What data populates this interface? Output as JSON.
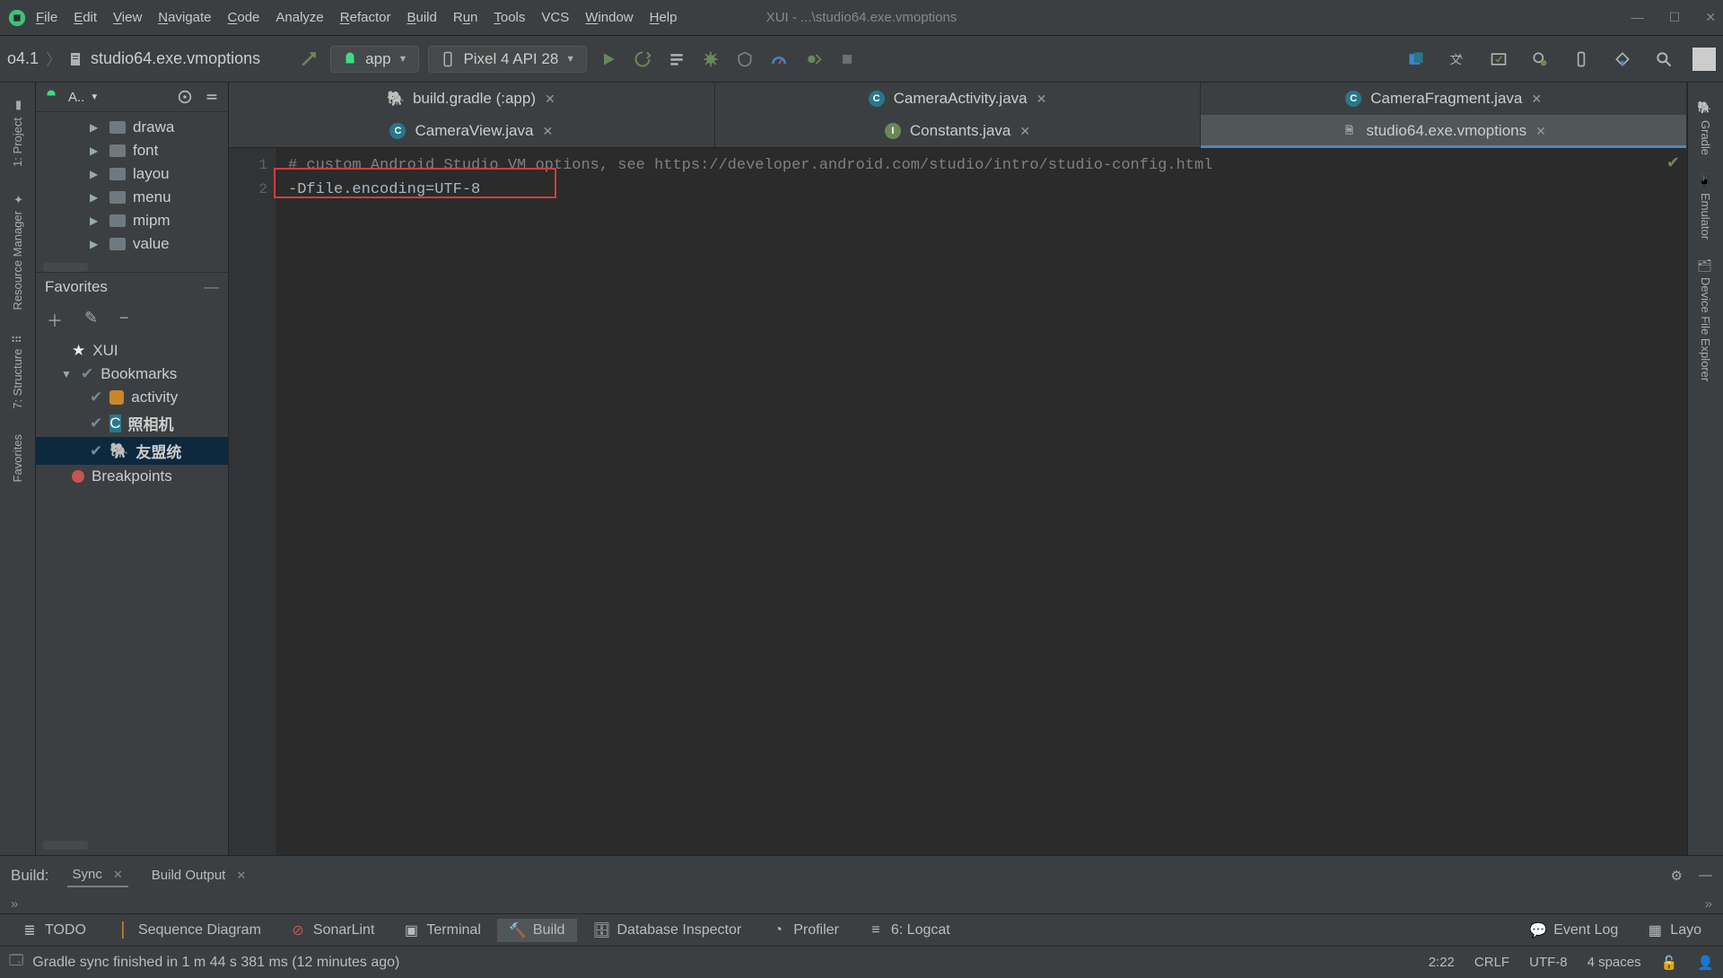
{
  "menu": [
    "File",
    "Edit",
    "View",
    "Navigate",
    "Code",
    "Analyze",
    "Refactor",
    "Build",
    "Run",
    "Tools",
    "VCS",
    "Window",
    "Help"
  ],
  "window_title": "XUI - ...\\studio64.exe.vmoptions",
  "breadcrumb": {
    "project": "o4.1",
    "file": "studio64.exe.vmoptions"
  },
  "run_config": {
    "module": "app",
    "device": "Pixel 4 API 28"
  },
  "left_gutter": [
    "1: Project",
    "Resource Manager",
    "7: Structure",
    "Favorites"
  ],
  "right_gutter": [
    "Gradle",
    "Emulator",
    "Device File Explorer"
  ],
  "project_panel": {
    "selector": "A..",
    "folders": [
      "drawa",
      "font",
      "layou",
      "menu",
      "mipm",
      "value"
    ]
  },
  "favorites": {
    "title": "Favorites",
    "items": {
      "xui": "XUI",
      "bookmarks": "Bookmarks",
      "b1": "activity",
      "b2": "照相机",
      "b3": "友盟统",
      "breakpoints": "Breakpoints"
    }
  },
  "tabs_row1": [
    {
      "icon": "g",
      "label": "build.gradle (:app)"
    },
    {
      "icon": "c",
      "label": "CameraActivity.java"
    },
    {
      "icon": "c",
      "label": "CameraFragment.java"
    }
  ],
  "tabs_row2": [
    {
      "icon": "c",
      "label": "CameraView.java"
    },
    {
      "icon": "i",
      "label": "Constants.java"
    },
    {
      "icon": "file",
      "label": "studio64.exe.vmoptions",
      "active": true
    }
  ],
  "editor": {
    "lines": [
      "# custom Android Studio VM options, see https://developer.android.com/studio/intro/studio-config.html",
      "-Dfile.encoding=UTF-8"
    ]
  },
  "build_header": {
    "label": "Build:",
    "tabs": [
      {
        "label": "Sync",
        "closable": true,
        "active": true
      },
      {
        "label": "Build Output",
        "closable": true,
        "active": false
      }
    ]
  },
  "bottom_tools": [
    {
      "icon": "≡",
      "label": "TODO"
    },
    {
      "icon": "seq",
      "label": "Sequence Diagram"
    },
    {
      "icon": "sonar",
      "label": "SonarLint"
    },
    {
      "icon": "term",
      "label": "Terminal"
    },
    {
      "icon": "build",
      "label": "Build",
      "active": true
    },
    {
      "icon": "db",
      "label": "Database Inspector"
    },
    {
      "icon": "prof",
      "label": "Profiler"
    },
    {
      "icon": "log",
      "label": "6: Logcat"
    },
    {
      "icon": "event",
      "label": "Event Log"
    },
    {
      "icon": "layout",
      "label": "Layo"
    }
  ],
  "status": {
    "message": "Gradle sync finished in 1 m 44 s 381 ms (12 minutes ago)",
    "caret": "2:22",
    "sep": "CRLF",
    "enc": "UTF-8",
    "indent": "4 spaces"
  }
}
